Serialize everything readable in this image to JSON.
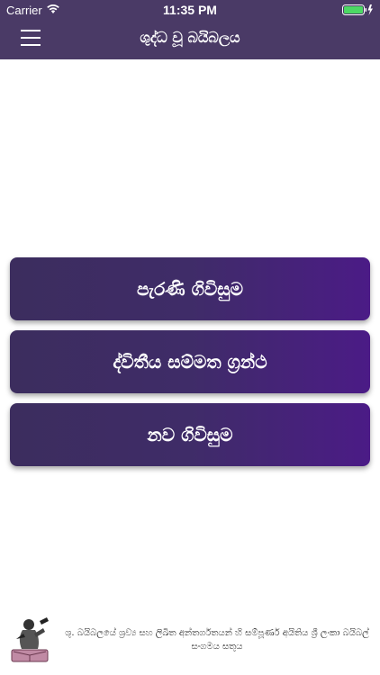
{
  "status_bar": {
    "carrier": "Carrier",
    "time": "11:35 PM"
  },
  "header": {
    "title": "ශුද්ධ වූ බයිබලය",
    "menu_icon": "hamburger-menu-icon",
    "background_color": "#4a3a66"
  },
  "main": {
    "buttons": [
      {
        "label": "පැරණි ගිවිසුම"
      },
      {
        "label": "ද්විතීය සම්මත ග්‍රන්ථ"
      },
      {
        "label": "නව ගිවිසුම"
      }
    ],
    "button_gradient": [
      "#3c2d5e",
      "#4b1b86"
    ]
  },
  "footer": {
    "credit": "ශු. බයිබලයේ ශ්‍රව්‍ය සහ ලිඛිත අන්තර්ගතයන් හි සම්පූර්ණ අයිතිය ශ්‍රී ලංකා බයිබල් සංගමය සතුය",
    "logo_icon": "bible-society-logo-icon"
  }
}
